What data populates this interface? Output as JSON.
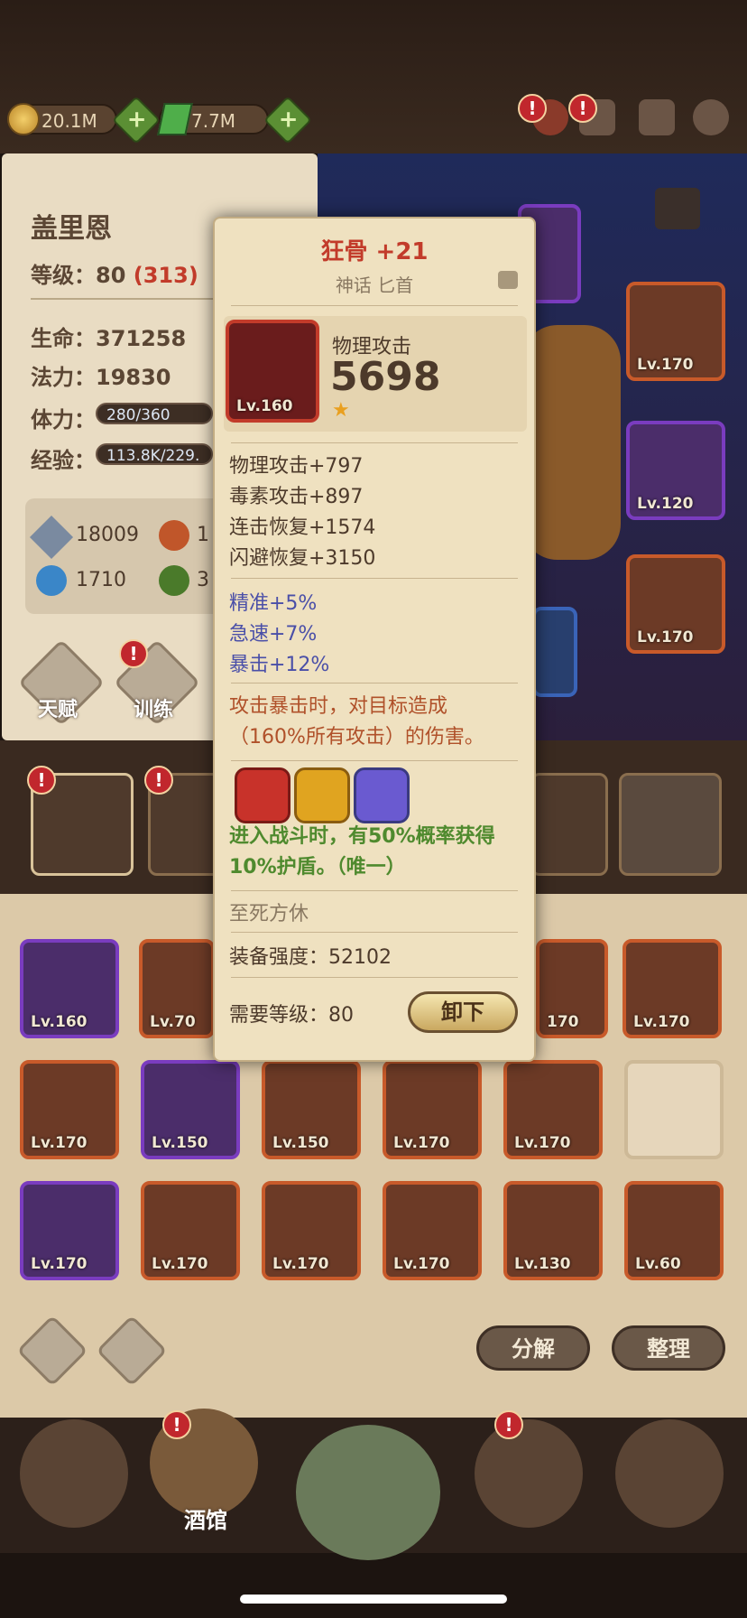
{
  "resources": {
    "gold": "20.1M",
    "gems": "7.7M"
  },
  "hero": {
    "name": "盖里恩",
    "level_label": "等级：",
    "level": "80",
    "level_extra": "(313)",
    "hp_label": "生命：",
    "hp": "371258",
    "mp_label": "法力：",
    "mp": "19830",
    "stamina_label": "体力：",
    "stamina": "280/360",
    "exp_label": "经验：",
    "exp": "113.8K/229.",
    "attrs": [
      "18009",
      "1",
      "1710",
      "3"
    ]
  },
  "side_buttons": {
    "talent": "天赋",
    "training": "训练"
  },
  "item_tooltip": {
    "title": "狂骨 +21",
    "subtitle": "神话 匕首",
    "stat_label": "物理攻击",
    "stat_value": "5698",
    "item_level": "Lv.160",
    "base_stats": [
      "物理攻击+797",
      "毒素攻击+897",
      "连击恢复+1574",
      "闪避恢复+3150"
    ],
    "bonus_stats": [
      "精准+5%",
      "急速+7%",
      "暴击+12%"
    ],
    "effect": "攻击暴击时，对目标造成（160%所有攻击）的伤害。",
    "gem_effect": "进入战斗时，有50%概率获得10%护盾。（唯一）",
    "set_name": "至死方休",
    "power_label": "装备强度：",
    "power": "52102",
    "req_label": "需要等级：",
    "req_level": "80",
    "unequip_label": "卸下"
  },
  "equipped_levels": [
    "Lv.170",
    "Lv.120",
    "Lv.170"
  ],
  "inventory": {
    "row1": [
      "Lv.160",
      "Lv.70",
      "170",
      "Lv.170"
    ],
    "row2": [
      "Lv.170",
      "Lv.150",
      "Lv.150",
      "Lv.170",
      "Lv.170",
      ""
    ],
    "row3": [
      "Lv.170",
      "Lv.170",
      "Lv.170",
      "Lv.170",
      "Lv.130",
      "Lv.60"
    ],
    "decompose_label": "分解",
    "sort_label": "整理"
  },
  "nav": {
    "tavern": "酒馆"
  },
  "badge_mark": "!",
  "colors": {
    "title_red": "#c23b2a",
    "bonus_blue": "#4a4fa8",
    "effect_brown": "#b0512a",
    "gem_green": "#4f8a2e"
  }
}
